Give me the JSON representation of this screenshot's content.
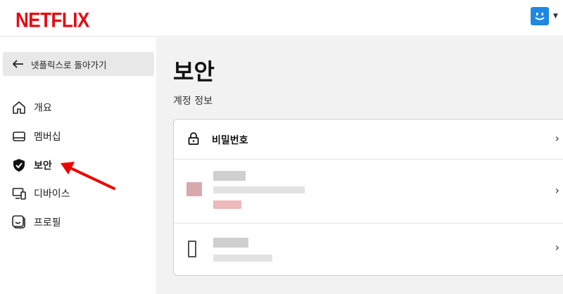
{
  "header": {
    "logo": "NETFLIX",
    "brand_color": "#e50914",
    "avatar_color": "#1e88e5",
    "avatar_icon": "smiley-avatar-icon",
    "caret_icon": "caret-down-icon"
  },
  "sidebar": {
    "back_label": "넷플릭스로 돌아가기",
    "items": [
      {
        "label": "개요",
        "icon": "home-icon"
      },
      {
        "label": "멤버십",
        "icon": "card-icon"
      },
      {
        "label": "보안",
        "icon": "shield-check-icon",
        "active": true
      },
      {
        "label": "디바이스",
        "icon": "devices-icon"
      },
      {
        "label": "프로필",
        "icon": "profile-icon"
      }
    ]
  },
  "main": {
    "title": "보안",
    "section": "계정 정보",
    "rows": [
      {
        "label": "비밀번호",
        "icon": "lock-icon"
      },
      {
        "label": "",
        "redacted": true
      },
      {
        "label": "",
        "redacted": true
      }
    ]
  }
}
